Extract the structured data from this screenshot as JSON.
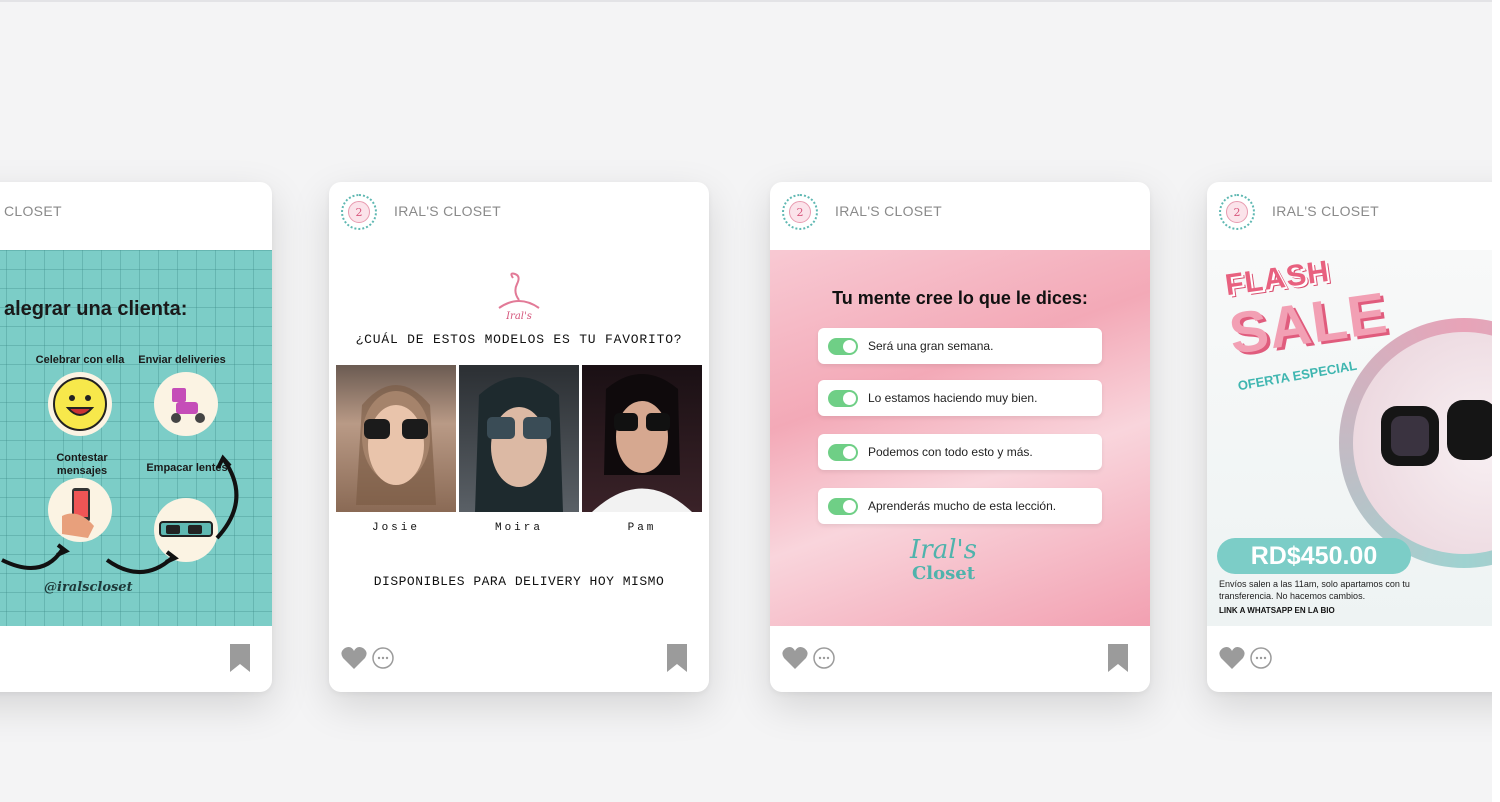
{
  "accent_teal": "#7ccdc7",
  "accent_pink": "#f2a0b4",
  "handle": "IRAL'S CLOSET",
  "cards": [
    {
      "handle": "CLOSET",
      "post": {
        "title": "alegrar una clienta:",
        "labels": [
          "Celebrar con ella",
          "Enviar deliveries",
          "Contestar mensajes",
          "Empacar lentes"
        ],
        "tag": "@iralscloset"
      }
    },
    {
      "handle": "IRAL'S CLOSET",
      "post": {
        "question": "¿CUÁL DE ESTOS MODELOS ES TU FAVORITO?",
        "models": [
          "Josie",
          "Moira",
          "Pam"
        ],
        "footer": "DISPONIBLES PARA DELIVERY HOY MISMO"
      }
    },
    {
      "handle": "IRAL'S CLOSET",
      "post": {
        "title": "Tu mente cree lo que le dices:",
        "items": [
          "Será una gran semana.",
          "Lo estamos haciendo muy bien.",
          "Podemos con todo esto y más.",
          "Aprenderás mucho de esta lección."
        ],
        "logo_line1": "Iral's",
        "logo_line2": "Closet"
      }
    },
    {
      "handle": "IRAL'S CLOSET",
      "post": {
        "flash": "FLASH",
        "sale": "SALE",
        "oferta": "OFERTA ESPECIAL",
        "price": "RD$450.00",
        "info": "Envíos salen a las 11am, solo apartamos con tu transferencia. No hacemos cambios.",
        "link": "LINK A WHATSAPP EN LA BIO"
      }
    }
  ],
  "icons": [
    "heart-icon",
    "comment-icon",
    "bookmark-icon",
    "avatar-logo-icon"
  ]
}
